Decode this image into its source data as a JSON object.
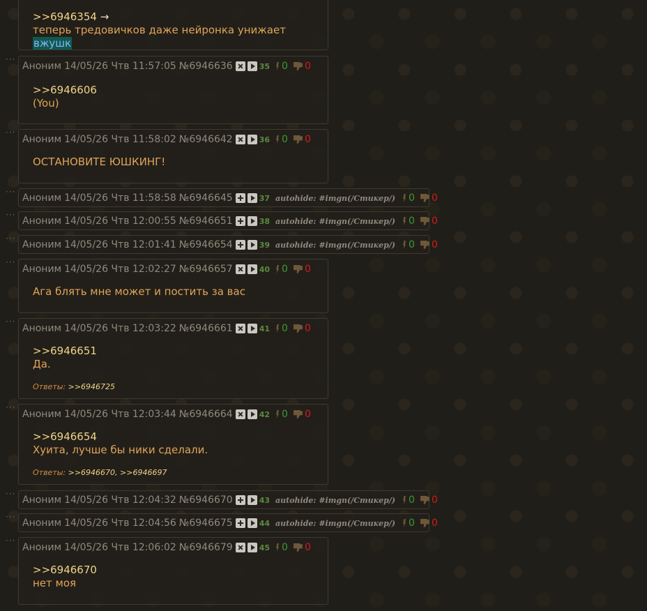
{
  "top_post": {
    "quote": ">>6946354",
    "arrow": "→",
    "text_before": "теперь тредовичков даже нейронка унижает ",
    "highlight": "вжушк"
  },
  "posts": [
    {
      "name": "Аноним",
      "date": "14/05/26 Чтв 11:57:05",
      "num": "№6946636",
      "idx": "35",
      "up": "0",
      "down": "0",
      "quote": ">>6946606",
      "text": "(You)"
    },
    {
      "name": "Аноним",
      "date": "14/05/26 Чтв 11:58:02",
      "num": "№6946642",
      "idx": "36",
      "up": "0",
      "down": "0",
      "text": "ОСТАНОВИТЕ ЮШКИНГ!"
    },
    {
      "name": "Аноним",
      "date": "14/05/26 Чтв 11:58:58",
      "num": "№6946645",
      "idx": "37",
      "up": "0",
      "down": "0",
      "autohide": "autohide: #imgn(/Стикер/)"
    },
    {
      "name": "Аноним",
      "date": "14/05/26 Чтв 12:00:55",
      "num": "№6946651",
      "idx": "38",
      "up": "0",
      "down": "0",
      "autohide": "autohide: #imgn(/Стикер/)"
    },
    {
      "name": "Аноним",
      "date": "14/05/26 Чтв 12:01:41",
      "num": "№6946654",
      "idx": "39",
      "up": "0",
      "down": "0",
      "autohide": "autohide: #imgn(/Стикер/)"
    },
    {
      "name": "Аноним",
      "date": "14/05/26 Чтв 12:02:27",
      "num": "№6946657",
      "idx": "40",
      "up": "0",
      "down": "0",
      "text": "Ага блять мне может и постить за вас"
    },
    {
      "name": "Аноним",
      "date": "14/05/26 Чтв 12:03:22",
      "num": "№6946661",
      "idx": "41",
      "up": "0",
      "down": "0",
      "quote": ">>6946651",
      "text": "Да.",
      "replies_label": "Ответы:",
      "replies": ">>6946725"
    },
    {
      "name": "Аноним",
      "date": "14/05/26 Чтв 12:03:44",
      "num": "№6946664",
      "idx": "42",
      "up": "0",
      "down": "0",
      "quote": ">>6946654",
      "text": "Хуита, лучше бы ники сделали.",
      "replies_label": "Ответы:",
      "replies": ">>6946670, >>6946697"
    },
    {
      "name": "Аноним",
      "date": "14/05/26 Чтв 12:04:32",
      "num": "№6946670",
      "idx": "43",
      "up": "0",
      "down": "0",
      "autohide": "autohide: #imgn(/Стикер/)"
    },
    {
      "name": "Аноним",
      "date": "14/05/26 Чтв 12:04:56",
      "num": "№6946675",
      "idx": "44",
      "up": "0",
      "down": "0",
      "autohide": "autohide: #imgn(/Стикер/)"
    },
    {
      "name": "Аноним",
      "date": "14/05/26 Чтв 12:06:02",
      "num": "№6946679",
      "idx": "45",
      "up": "0",
      "down": "0",
      "quote": ">>6946670",
      "text": "нет моя"
    }
  ],
  "dots": "···"
}
